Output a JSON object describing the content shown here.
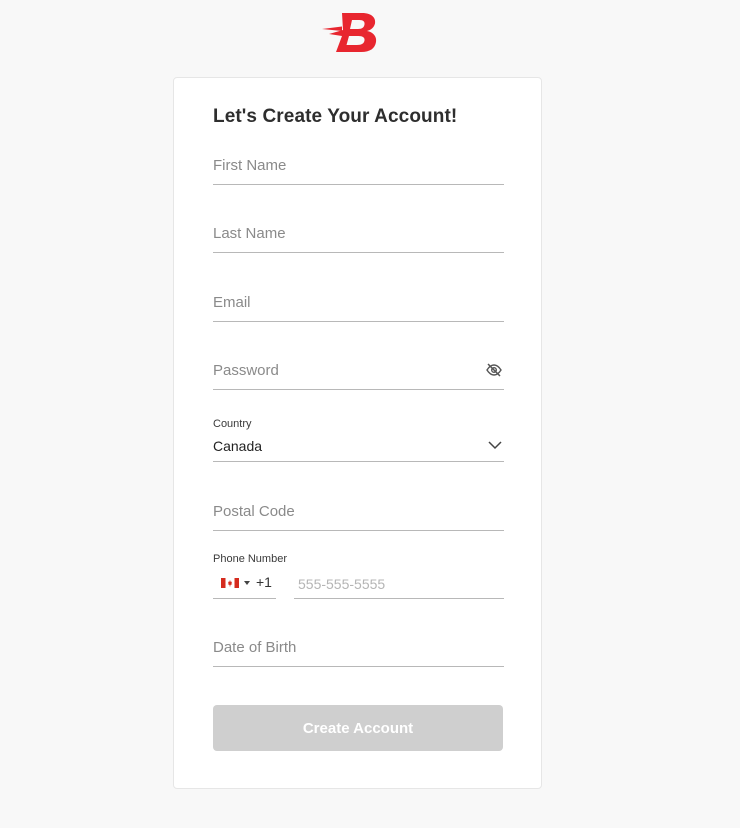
{
  "brand": {
    "logo_icon": "brand-b-icon",
    "logo_letter": "B",
    "color": "#e8262f"
  },
  "form": {
    "title": "Let's Create Your Account!",
    "first_name": {
      "placeholder": "First Name",
      "value": ""
    },
    "last_name": {
      "placeholder": "Last Name",
      "value": ""
    },
    "email": {
      "placeholder": "Email",
      "value": ""
    },
    "password": {
      "placeholder": "Password",
      "value": "",
      "toggle_icon": "eye-slash-icon"
    },
    "country": {
      "label": "Country",
      "value": "Canada",
      "icon": "chevron-down-icon"
    },
    "postal_code": {
      "placeholder": "Postal Code",
      "value": ""
    },
    "phone": {
      "label": "Phone Number",
      "flag_icon": "canada-flag-icon",
      "dial_code": "+1",
      "placeholder": "555-555-5555",
      "value": ""
    },
    "date_of_birth": {
      "placeholder": "Date of Birth",
      "value": ""
    },
    "submit_label": "Create Account",
    "submit_enabled": false
  },
  "colors": {
    "background": "#f8f8f8",
    "card": "#ffffff",
    "button_disabled": "#cfcfcf",
    "underline": "#b8b8b8"
  }
}
